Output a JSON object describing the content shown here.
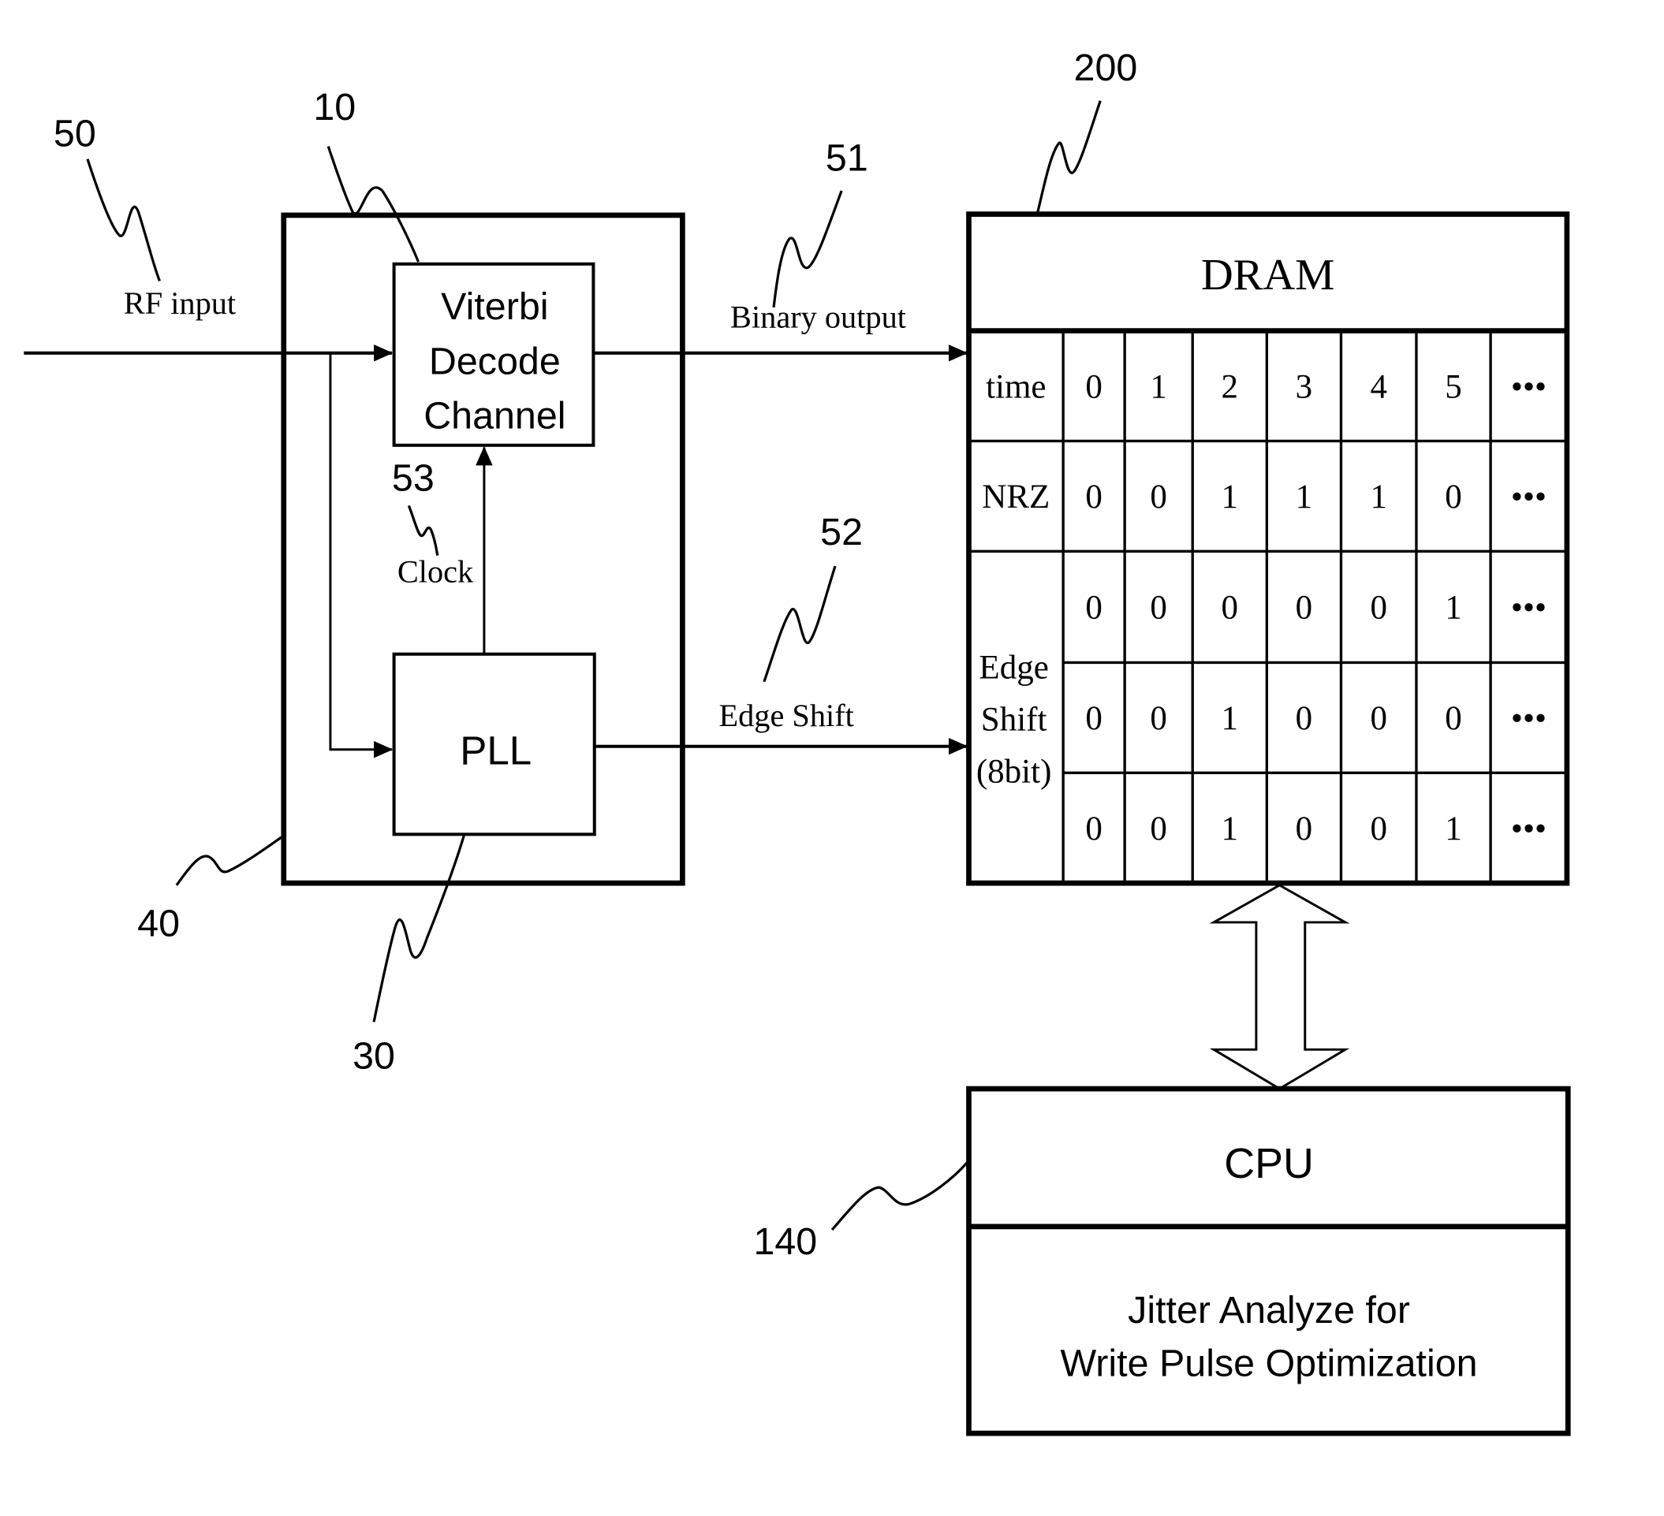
{
  "colors": {
    "ink": "#000000",
    "background": "#ffffff"
  },
  "refs": {
    "rf_input": "50",
    "viterbi": "10",
    "binary_output": "51",
    "dram": "200",
    "clock": "53",
    "edge_shift": "52",
    "read_channel": "40",
    "pll": "30",
    "cpu": "140"
  },
  "signals": {
    "rf_input": "RF input",
    "binary_output": "Binary output",
    "clock": "Clock",
    "edge_shift": "Edge Shift"
  },
  "blocks": {
    "viterbi": [
      "Viterbi",
      "Decode",
      "Channel"
    ],
    "pll": "PLL",
    "dram": "DRAM",
    "cpu": "CPU",
    "cpu_function": [
      "Jitter Analyze for",
      "Write Pulse Optimization"
    ]
  },
  "dram_table": {
    "time_label": "time",
    "time": [
      "0",
      "1",
      "2",
      "3",
      "4",
      "5",
      "•••"
    ],
    "nrz_label": "NRZ",
    "nrz": [
      "0",
      "0",
      "1",
      "1",
      "1",
      "0",
      "•••"
    ],
    "edge_label": [
      "Edge",
      "Shift",
      "(8bit)"
    ],
    "edge_rows": [
      [
        "0",
        "0",
        "0",
        "0",
        "0",
        "1",
        "•••"
      ],
      [
        "0",
        "0",
        "1",
        "0",
        "0",
        "0",
        "•••"
      ],
      [
        "0",
        "0",
        "1",
        "0",
        "0",
        "1",
        "•••"
      ]
    ]
  }
}
